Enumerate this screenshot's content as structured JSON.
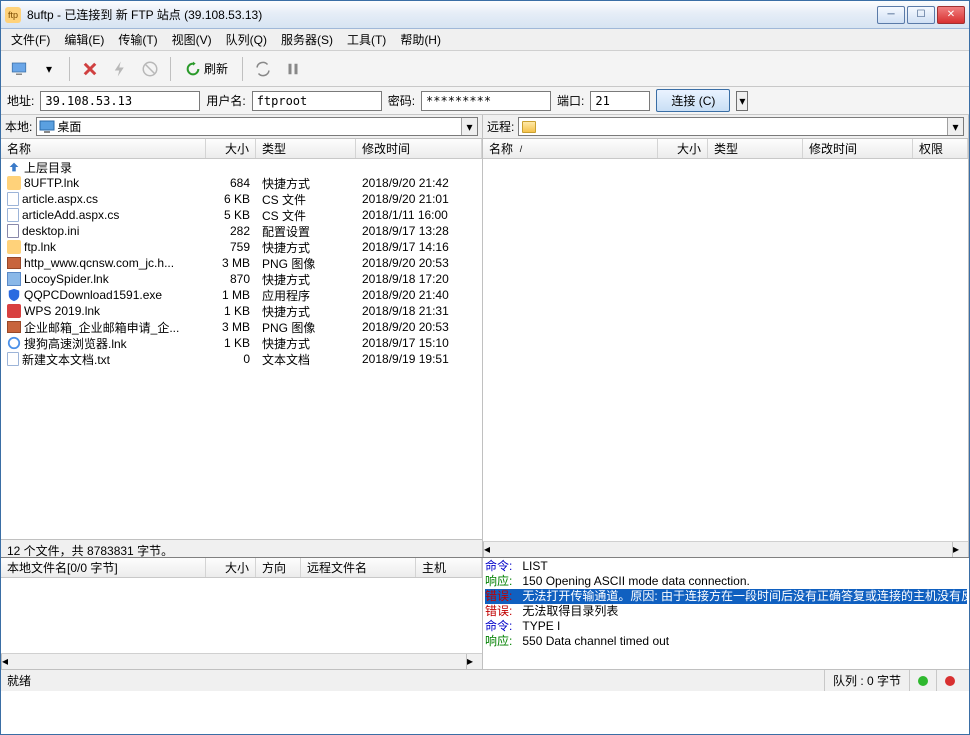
{
  "window": {
    "title": "8uftp - 已连接到 新 FTP 站点 (39.108.53.13)"
  },
  "menu": {
    "file": "文件(F)",
    "edit": "编辑(E)",
    "transfer": "传输(T)",
    "view": "视图(V)",
    "queue": "队列(Q)",
    "server": "服务器(S)",
    "tools": "工具(T)",
    "help": "帮助(H)"
  },
  "toolbar": {
    "refresh": "刷新"
  },
  "conn": {
    "addr_label": "地址:",
    "addr": "39.108.53.13",
    "user_label": "用户名:",
    "user": "ftproot",
    "pass_label": "密码:",
    "pass": "*********",
    "port_label": "端口:",
    "port": "21",
    "connect_btn": "连接 (C)"
  },
  "local": {
    "label": "本地:",
    "path": "桌面",
    "cols": {
      "name": "名称",
      "size": "大小",
      "type": "类型",
      "mtime": "修改时间"
    },
    "rows": [
      {
        "icon": "up",
        "name": "上层目录",
        "size": "",
        "type": "",
        "mtime": ""
      },
      {
        "icon": "ftp",
        "name": "8UFTP.lnk",
        "size": "684",
        "type": "快捷方式",
        "mtime": "2018/9/20 21:42"
      },
      {
        "icon": "file",
        "name": "article.aspx.cs",
        "size": "6 KB",
        "type": "CS 文件",
        "mtime": "2018/9/20 21:01"
      },
      {
        "icon": "file",
        "name": "articleAdd.aspx.cs",
        "size": "5 KB",
        "type": "CS 文件",
        "mtime": "2018/1/11 16:00"
      },
      {
        "icon": "ini",
        "name": "desktop.ini",
        "size": "282",
        "type": "配置设置",
        "mtime": "2018/9/17 13:28"
      },
      {
        "icon": "ftp",
        "name": "ftp.lnk",
        "size": "759",
        "type": "快捷方式",
        "mtime": "2018/9/17 14:16"
      },
      {
        "icon": "png",
        "name": "http_www.qcnsw.com_jc.h...",
        "size": "3 MB",
        "type": "PNG 图像",
        "mtime": "2018/9/20 20:53"
      },
      {
        "icon": "app",
        "name": "LocoySpider.lnk",
        "size": "870",
        "type": "快捷方式",
        "mtime": "2018/9/18 17:20"
      },
      {
        "icon": "shield",
        "name": "QQPCDownload1591.exe",
        "size": "1 MB",
        "type": "应用程序",
        "mtime": "2018/9/20 21:40"
      },
      {
        "icon": "wps",
        "name": "WPS 2019.lnk",
        "size": "1 KB",
        "type": "快捷方式",
        "mtime": "2018/9/18 21:31"
      },
      {
        "icon": "png",
        "name": "企业邮箱_企业邮箱申请_企...",
        "size": "3 MB",
        "type": "PNG 图像",
        "mtime": "2018/9/20 20:53"
      },
      {
        "icon": "browser",
        "name": "搜狗高速浏览器.lnk",
        "size": "1 KB",
        "type": "快捷方式",
        "mtime": "2018/9/17 15:10"
      },
      {
        "icon": "file",
        "name": "新建文本文档.txt",
        "size": "0",
        "type": "文本文档",
        "mtime": "2018/9/19 19:51"
      }
    ],
    "status": "12 个文件，共 8783831 字节。"
  },
  "remote": {
    "label": "远程:",
    "cols": {
      "name": "名称",
      "size": "大小",
      "type": "类型",
      "mtime": "修改时间",
      "perm": "权限"
    }
  },
  "queue": {
    "cols": {
      "localname": "本地文件名[0/0 字节]",
      "size": "大小",
      "dir": "方向",
      "remotename": "远程文件名",
      "host": "主机"
    }
  },
  "log": [
    {
      "cls": "cmd",
      "label": "命令:",
      "text": "LIST"
    },
    {
      "cls": "resp",
      "label": "响应:",
      "text": "150 Opening ASCII mode data connection."
    },
    {
      "cls": "err hl",
      "label": "错误:",
      "text": "无法打开传输通道。原因: 由于连接方在一段时间后没有正确答复或连接的主机没有反应，连接尝试失败。"
    },
    {
      "cls": "err",
      "label": "错误:",
      "text": "无法取得目录列表"
    },
    {
      "cls": "cmd",
      "label": "命令:",
      "text": "TYPE I"
    },
    {
      "cls": "resp",
      "label": "响应:",
      "text": "550 Data channel timed out"
    }
  ],
  "status": {
    "ready": "就绪",
    "queue": "队列 : 0 字节"
  }
}
